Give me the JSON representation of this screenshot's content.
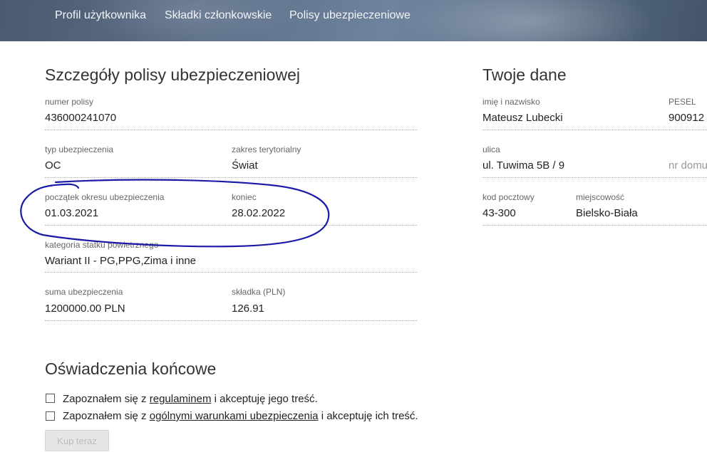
{
  "nav": {
    "items": [
      {
        "label": "Profil użytkownika"
      },
      {
        "label": "Składki członkowskie"
      },
      {
        "label": "Polisy ubezpieczeniowe"
      }
    ]
  },
  "policy": {
    "title": "Szczegóły polisy ubezpieczeniowej",
    "number_label": "numer polisy",
    "number_value": "436000241070",
    "type_label": "typ ubezpieczenia",
    "type_value": "OC",
    "territory_label": "zakres terytorialny",
    "territory_value": "Świat",
    "start_label": "początek okresu ubezpieczenia",
    "start_value": "01.03.2021",
    "end_label": "koniec",
    "end_value": "28.02.2022",
    "category_label": "kategoria statku powietrznego",
    "category_value": "Wariant II - PG,PPG,Zima i inne",
    "sum_label": "suma ubezpieczenia",
    "sum_value": "1200000.00 PLN",
    "premium_label": "składka (PLN)",
    "premium_value": "126.91"
  },
  "user": {
    "title": "Twoje dane",
    "name_label": "imię i nazwisko",
    "name_value": "Mateusz Lubecki",
    "pesel_label": "PESEL",
    "pesel_value": "900912",
    "street_label": "ulica",
    "street_value": "ul. Tuwima 5B / 9",
    "house_placeholder": "nr domu",
    "postal_label": "kod pocztowy",
    "postal_value": "43-300",
    "city_label": "miejscowość",
    "city_value": "Bielsko-Biała"
  },
  "declarations": {
    "title": "Oświadczenia końcowe",
    "items": [
      {
        "prefix": "Zapoznałem się z ",
        "link": "regulaminem",
        "suffix": " i akceptuję jego treść."
      },
      {
        "prefix": "Zapoznałem się z ",
        "link": "ogólnymi warunkami ubezpieczenia",
        "suffix": " i akceptuję ich treść."
      }
    ],
    "buy_label": "Kup teraz"
  },
  "colors": {
    "annotation": "#1a1aa8"
  }
}
